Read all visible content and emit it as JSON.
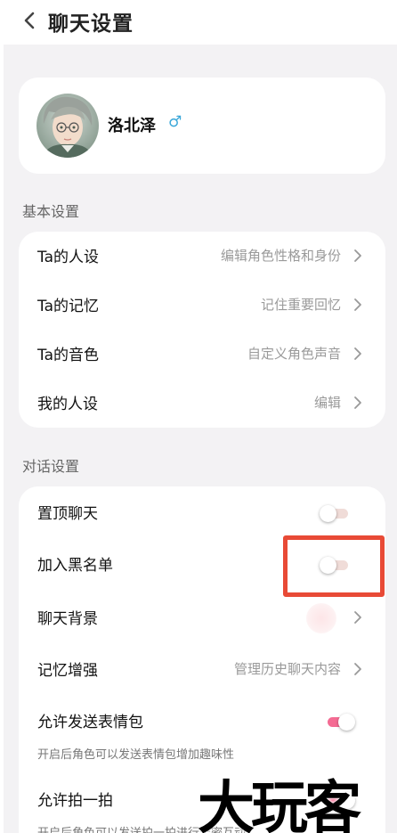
{
  "header": {
    "title": "聊天设置"
  },
  "profile": {
    "name": "洛北泽",
    "gender_symbol": "♂"
  },
  "basic_settings": {
    "section_label": "基本设置",
    "items": [
      {
        "label": "Ta的人设",
        "value": "编辑角色性格和身份"
      },
      {
        "label": "Ta的记忆",
        "value": "记住重要回忆"
      },
      {
        "label": "Ta的音色",
        "value": "自定义角色声音"
      },
      {
        "label": "我的人设",
        "value": "编辑"
      }
    ]
  },
  "dialog_settings": {
    "section_label": "对话设置",
    "items": [
      {
        "label": "置顶聊天",
        "toggle": false
      },
      {
        "label": "加入黑名单",
        "toggle": false
      },
      {
        "label": "聊天背景"
      },
      {
        "label": "记忆增强",
        "value": "管理历史聊天内容"
      },
      {
        "label": "允许发送表情包",
        "toggle": true,
        "description": "开启后角色可以发送表情包增加趣味性"
      },
      {
        "label": "允许拍一拍",
        "toggle": true,
        "description": "开启后角色可以发送拍一拍进行亲密互动"
      }
    ]
  },
  "colors": {
    "toggle_on": "#f46b93",
    "toggle_off": "#f0dcd8",
    "highlight_box": "#e84a36",
    "gender_icon": "#3aa7d9"
  },
  "watermark": {
    "text": "大玩客"
  }
}
